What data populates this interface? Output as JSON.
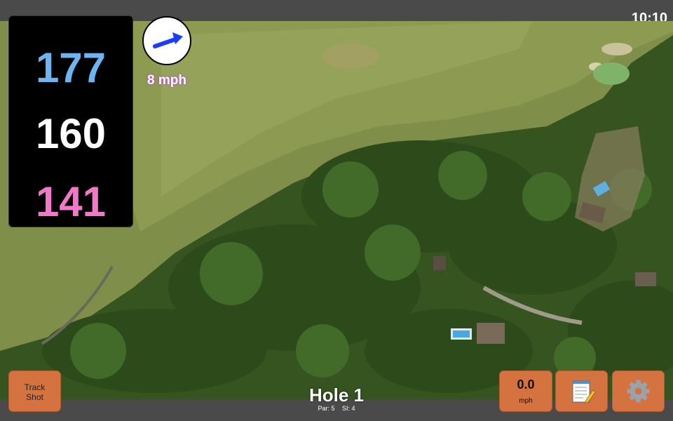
{
  "status": {
    "time": "10:10"
  },
  "distances": {
    "back": "177",
    "middle": "160",
    "front": "141",
    "colors": {
      "back": "#6eb4f0",
      "middle": "#ffffff",
      "front": "#f07ac8"
    }
  },
  "wind": {
    "speed_label": "8 mph",
    "arrow_icon": "wind-direction-arrow-icon",
    "arrow_color": "#1a3cff"
  },
  "hole": {
    "title": "Hole 1",
    "par": "Par: 5",
    "si": "SI: 4"
  },
  "buttons": {
    "track_shot_line1": "Track",
    "track_shot_line2": "Shot",
    "speed_value": "0.0",
    "speed_unit": "mph",
    "notes_icon": "notepad-icon",
    "settings_icon": "gear-icon",
    "button_color": "#d4733f"
  }
}
